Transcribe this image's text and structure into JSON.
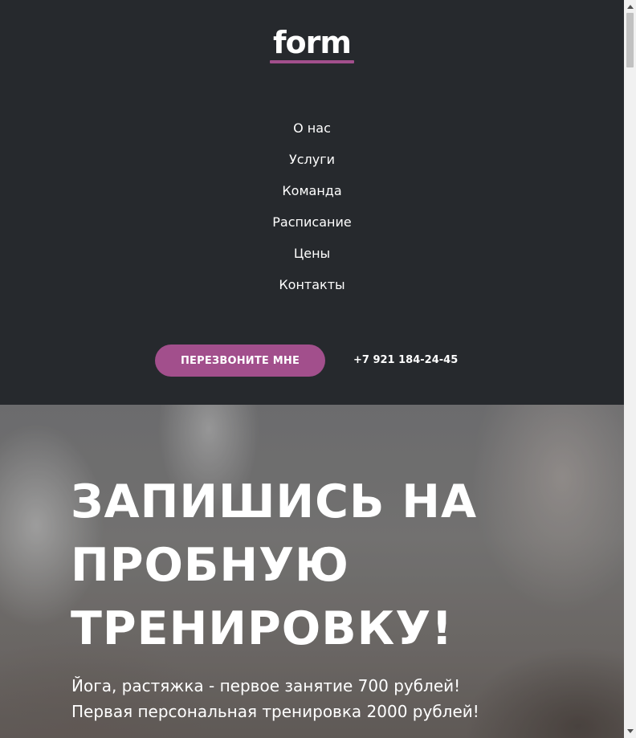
{
  "header": {
    "logo_text": "form",
    "nav": [
      {
        "label": "О нас"
      },
      {
        "label": "Услуги"
      },
      {
        "label": "Команда"
      },
      {
        "label": "Расписание"
      },
      {
        "label": "Цены"
      },
      {
        "label": "Контакты"
      }
    ],
    "callback_label": "ПЕРЕЗВОНИТЕ МНЕ",
    "phone": "+7 921 184-24-45"
  },
  "hero": {
    "title_lines": [
      "ЗАПИШИСЬ НА",
      "ПРОБНУЮ",
      "ТРЕНИРОВКУ!"
    ],
    "text_lines": [
      "Йога, растяжка - первое занятие 700 рублей!",
      "Первая персональная тренировка 2000 рублей!"
    ]
  },
  "colors": {
    "header_bg": "#26292d",
    "accent": "#a24f8c",
    "text": "#ffffff"
  }
}
